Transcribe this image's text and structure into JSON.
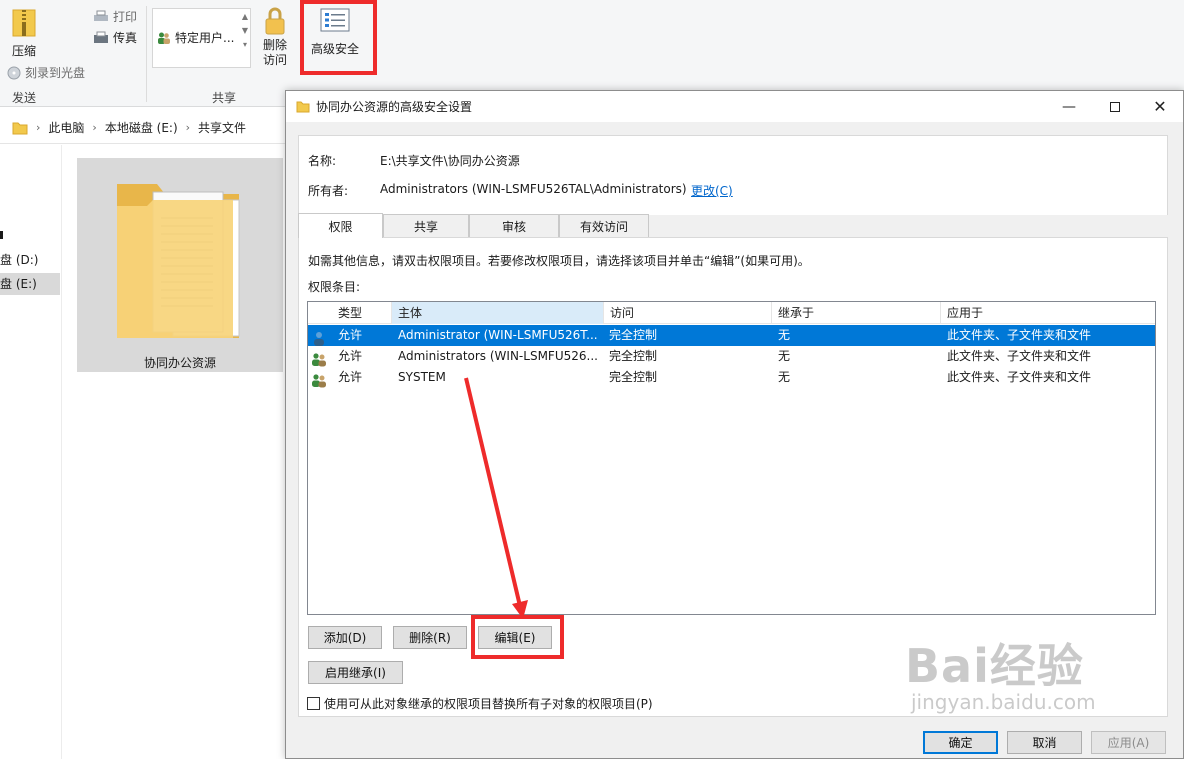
{
  "ribbon": {
    "compress_label": "压缩",
    "burn_label": "刻录到光盘",
    "print_label": "打印",
    "fax_label": "传真",
    "group_send": "发送",
    "share_combo_label": "特定用户...",
    "remove_access_label": "删除\n访问",
    "advanced_security_label": "高级安全",
    "group_share": "共享"
  },
  "address": {
    "crumbs": [
      "此电脑",
      "本地磁盘 (E:)",
      "共享文件"
    ]
  },
  "nav": {
    "items": [
      "盘 (D:)",
      "盘 (E:)"
    ]
  },
  "content": {
    "folder_name": "协同办公资源"
  },
  "dialog": {
    "title": "协同办公资源的高级安全设置",
    "name_label": "名称:",
    "name_value": "E:\\共享文件\\协同办公资源",
    "owner_label": "所有者:",
    "owner_value": "Administrators (WIN-LSMFU526TAL\\Administrators)",
    "change_link": "更改(C)",
    "tabs": [
      "权限",
      "共享",
      "审核",
      "有效访问"
    ],
    "info_text": "如需其他信息，请双击权限项目。若要修改权限项目，请选择该项目并单击“编辑”(如果可用)。",
    "entries_label": "权限条目:",
    "columns": [
      "类型",
      "主体",
      "访问",
      "继承于",
      "应用于"
    ],
    "rows": [
      {
        "type": "允许",
        "principal": "Administrator (WIN-LSMFU526T...",
        "access": "完全控制",
        "inherited": "无",
        "applies": "此文件夹、子文件夹和文件"
      },
      {
        "type": "允许",
        "principal": "Administrators (WIN-LSMFU526...",
        "access": "完全控制",
        "inherited": "无",
        "applies": "此文件夹、子文件夹和文件"
      },
      {
        "type": "允许",
        "principal": "SYSTEM",
        "access": "完全控制",
        "inherited": "无",
        "applies": "此文件夹、子文件夹和文件"
      }
    ],
    "add_button": "添加(D)",
    "remove_button": "删除(R)",
    "edit_button": "编辑(E)",
    "enable_inheritance_button": "启用继承(I)",
    "replace_checkbox_label": "使用可从此对象继承的权限项目替换所有子对象的权限项目(P)",
    "ok_button": "确定",
    "cancel_button": "取消",
    "apply_button": "应用(A)"
  },
  "watermark": {
    "brand": "Bai经验",
    "url": "jingyan.baidu.com"
  },
  "colors": {
    "highlight_red": "#ee2b2b",
    "selection_blue": "#0078d7"
  }
}
